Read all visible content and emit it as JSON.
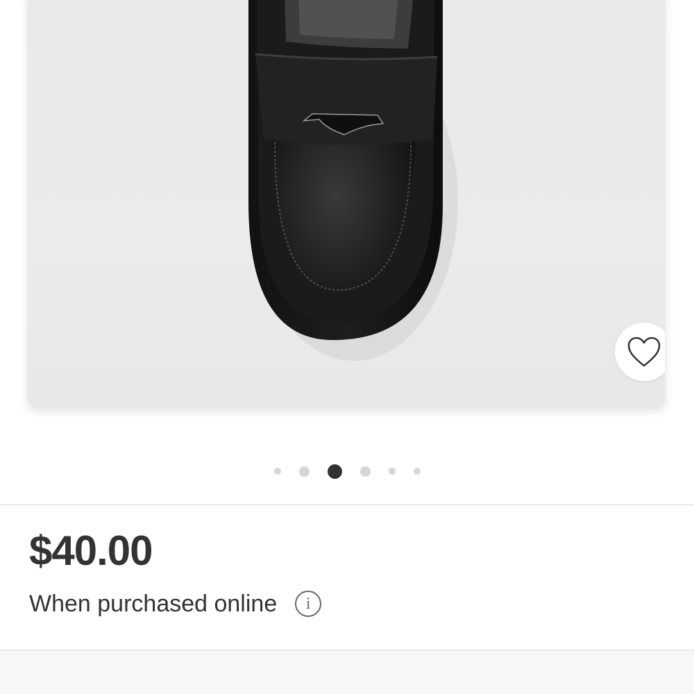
{
  "product": {
    "image_alt": "Black faux leather penny loafer with lug sole",
    "favorite_icon": "heart-outline-icon",
    "price": "$40.00",
    "price_note": "When purchased online",
    "info_icon_glyph": "i"
  },
  "carousel": {
    "total_images": 6,
    "active_index": 2
  },
  "colors": {
    "text": "#333333",
    "divider": "#d6d6d6",
    "dot_inactive": "#d6d6d6",
    "dot_active": "#333333"
  }
}
